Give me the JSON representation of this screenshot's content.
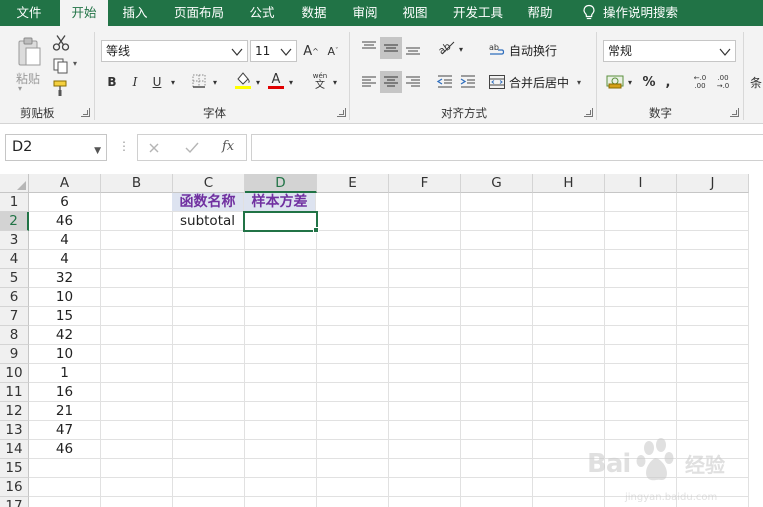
{
  "ribbon_tabs": [
    "文件",
    "开始",
    "插入",
    "页面布局",
    "公式",
    "数据",
    "审阅",
    "视图",
    "开发工具",
    "帮助"
  ],
  "active_tab": "开始",
  "tell_me": "操作说明搜索",
  "clipboard": {
    "paste_label": "粘贴",
    "group_label": "剪贴板"
  },
  "font": {
    "name": "等线",
    "size": "11",
    "group_label": "字体"
  },
  "alignment": {
    "wrap_label": "自动换行",
    "merge_label": "合并后居中",
    "group_label": "对齐方式"
  },
  "number": {
    "format": "常规",
    "group_label": "数字",
    "percent": "%",
    "comma": ",",
    "inc_decimal": "←.0 .00",
    "dec_decimal": ".00 →.0"
  },
  "next_group_stub": "条",
  "formula_bar": {
    "name_box": "D2",
    "fx": "fx",
    "content": ""
  },
  "columns": [
    "A",
    "B",
    "C",
    "D",
    "E",
    "F",
    "G",
    "H",
    "I",
    "J"
  ],
  "rows": [
    "1",
    "2",
    "3",
    "4",
    "5",
    "6",
    "7",
    "8",
    "9",
    "10",
    "11",
    "12",
    "13",
    "14",
    "15",
    "16",
    "17"
  ],
  "column_a": [
    "6",
    "46",
    "4",
    "4",
    "32",
    "10",
    "15",
    "42",
    "10",
    "1",
    "16",
    "21",
    "47",
    "46"
  ],
  "c1": "函数名称",
  "d1": "样本方差",
  "c2": "subtotal",
  "active_cell": "D2",
  "colors": {
    "accent": "#217346",
    "header_fill": "#dde3f0",
    "header_text": "#7030a0"
  },
  "watermark": {
    "brand": "Bai du 经验",
    "url": "jingyan.baidu.com"
  }
}
